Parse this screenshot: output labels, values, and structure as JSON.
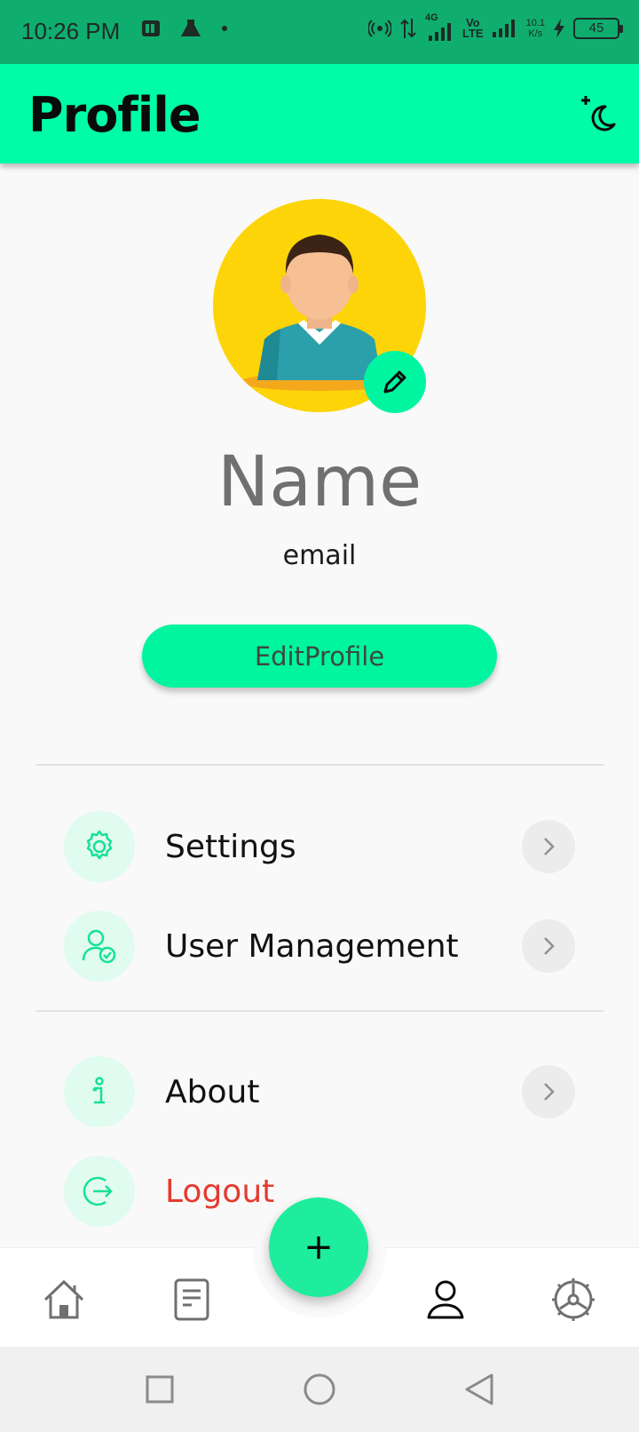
{
  "status_bar": {
    "time": "10:26 PM",
    "network_4g": "4G",
    "volte": "Vo\nLTE",
    "speed": "10.1\nK/s",
    "battery": "45"
  },
  "app_bar": {
    "title": "Profile"
  },
  "profile": {
    "name": "Name",
    "email": "email",
    "edit_button_label": "EditProfile"
  },
  "menu": {
    "settings": "Settings",
    "user_management": "User Management",
    "about": "About",
    "logout": "Logout"
  },
  "fab": {
    "label": "+"
  },
  "colors": {
    "accent": "#00fca6",
    "status_bar": "#0fae6e",
    "avatar_bg": "#fdd408",
    "logout": "#e43b2f"
  },
  "icons": {
    "theme": "moon-sparkle-icon",
    "avatar_edit": "pencil-icon",
    "settings": "gear-icon",
    "user_management": "user-check-icon",
    "about": "info-icon",
    "logout": "logout-icon",
    "chevron": "chevron-right-icon",
    "nav": [
      "home-icon",
      "document-icon",
      "person-icon",
      "settings-wheel-icon"
    ],
    "system_nav": [
      "square-icon",
      "circle-icon",
      "triangle-back-icon"
    ]
  },
  "bottom_nav": {
    "active": "profile"
  }
}
